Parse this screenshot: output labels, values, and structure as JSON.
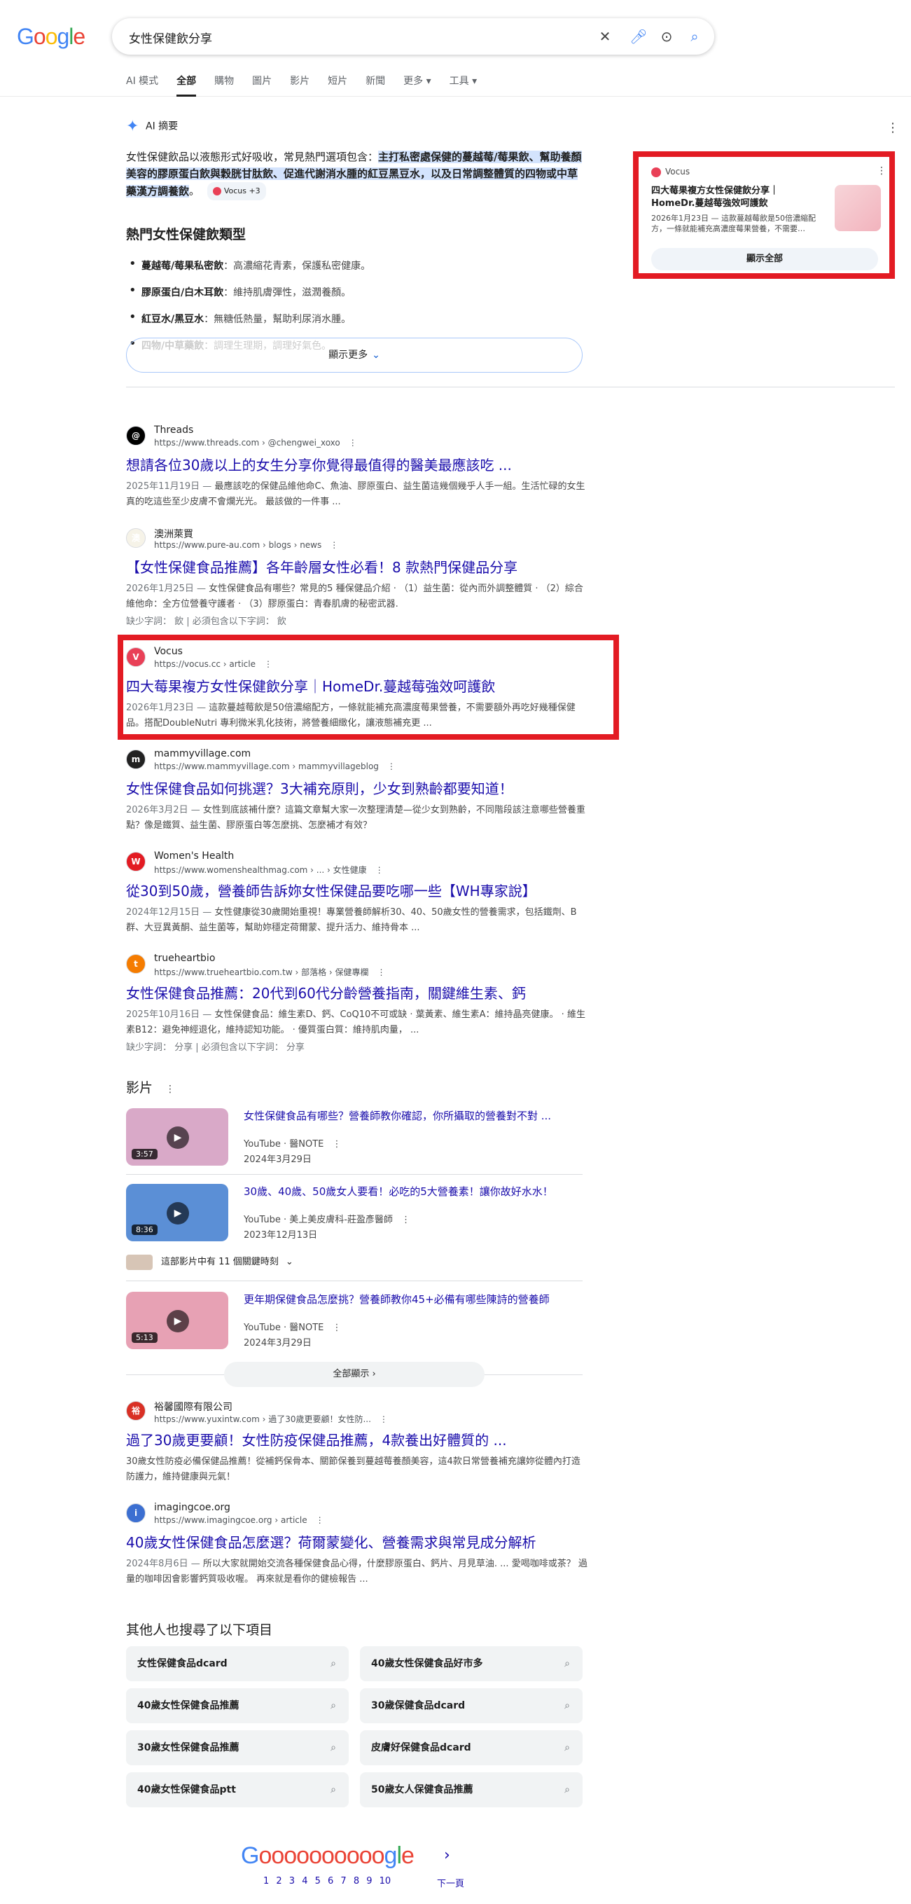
{
  "header": {
    "logo": "Google",
    "search_query": "女性保健飲分享",
    "tabs": [
      "AI 模式",
      "全部",
      "購物",
      "圖片",
      "影片",
      "短片",
      "新聞",
      "更多 ▾",
      "工具 ▾"
    ],
    "active_tab": "全部"
  },
  "ai_overview": {
    "heading": "AI 摘要",
    "intro_plain": "女性保健飲品以液態形式好吸收，常見熱門選項包含：",
    "intro_bold": "主打私密處保健的蔓越莓/莓果飲、幫助養顏美容的膠原蛋白飲與穀胱甘肽飲、促進代謝消水腫的紅豆黑豆水，以及日常調整體質的四物或中草藥漢方調養飲",
    "intro_end": "。",
    "chip": "Vocus +3",
    "subtitle": "熱門女性保健飲類型",
    "items": [
      {
        "bold": "蔓越莓/莓果私密飲",
        "text": "：高濃縮花青素，保護私密健康。"
      },
      {
        "bold": "膠原蛋白/白木耳飲",
        "text": "：維持肌膚彈性，滋潤養顏。"
      },
      {
        "bold": "紅豆水/黑豆水",
        "text": "：無糖低熱量，幫助利尿消水腫。"
      },
      {
        "bold": "四物/中草藥飲",
        "text": "：調理生理期，調理好氣色。"
      }
    ],
    "show_more": "顯示更多"
  },
  "side_card": {
    "source": "Vocus",
    "title": "四大莓果複方女性保健飲分享｜HomeDr.蔓越莓強效呵護飲",
    "snippet": "2026年1月23日 — 這款蔓越莓飲是50倍濃縮配方，一條就能補充高濃度莓果營養，不需要…",
    "show_all": "顯示全部"
  },
  "results": [
    {
      "name": "Threads",
      "url": "https://www.threads.com › @chengwei_xoxo",
      "title": "想請各位30歲以上的女生分享你覺得最值得的醫美最應該吃 ...",
      "date": "2025年11月19日 — ",
      "snippet": "最應該吃的保健品維他命C、魚油、膠原蛋白、益生菌這幾個幾乎人手一組。生活忙碌的女生真的吃這些至少皮膚不會爛光光。 最該做的一件事 ...",
      "missing": "",
      "fav_color": "#000000",
      "fav_char": "@"
    },
    {
      "name": "澳洲萊買",
      "url": "https://www.pure-au.com › blogs › news",
      "title": "【女性保健食品推薦】各年齡層女性必看！8 款熱門保健品分享",
      "date": "2026年1月25日 — ",
      "snippet": "女性保健食品有哪些？常見的5 種保健品介紹 · （1）益生菌：從內而外調整體質 · （2）綜合維他命：全方位營養守護者 · （3）膠原蛋白：青春肌膚的秘密武器.",
      "missing": "缺少字詞： 飲 | 必須包含以下字詞： 飲",
      "fav_color": "#f6f3e8",
      "fav_char": "澳"
    },
    {
      "name": "Vocus",
      "url": "https://vocus.cc › article",
      "title": "四大莓果複方女性保健飲分享｜HomeDr.蔓越莓強效呵護飲",
      "date": "2026年1月23日 — ",
      "snippet": "這款蔓越莓飲是50倍濃縮配方，一條就能補充高濃度莓果營養，不需要額外再吃好幾種保健品。搭配DoubleNutri 專利微米乳化技術，將營養細緻化，讓液態補充更 ...",
      "missing": "",
      "fav_color": "#e94057",
      "fav_char": "V"
    },
    {
      "name": "mammyvillage.com",
      "url": "https://www.mammyvillage.com › mammyvillageblog",
      "title": "女性保健食品如何挑選？3大補充原則，少女到熟齡都要知道！",
      "date": "2026年3月2日 — ",
      "snippet": "女性到底該補什麼？這篇文章幫大家一次整理清楚—從少女到熟齡，不同階段該注意哪些營養重點？像是鐵質、益生菌、膠原蛋白等怎麼挑、怎麼補才有效？",
      "missing": "",
      "fav_color": "#222222",
      "fav_char": "m"
    },
    {
      "name": "Women's Health",
      "url": "https://www.womenshealthmag.com › ... › 女性健康",
      "title": "從30到50歲，營養師告訴妳女性保健品要吃哪一些【WH專家說】",
      "date": "2024年12月15日 — ",
      "snippet": "女性健康從30歲開始重視！專業營養師解析30、40、50歲女性的營養需求，包括鐵劑、B群、大豆異黃酮、益生菌等，幫助妳穩定荷爾蒙、提升活力、維持骨本 ...",
      "missing": "",
      "fav_color": "#e31b23",
      "fav_char": "W"
    },
    {
      "name": "trueheartbio",
      "url": "https://www.trueheartbio.com.tw › 部落格 › 保健專欄",
      "title": "女性保健食品推薦：20代到60代分齡營養指南，關鍵維生素、鈣",
      "date": "2025年10月16日 — ",
      "snippet": "女性保健食品：維生素D、鈣、CoQ10不可或缺 · 葉黃素、維生素A：維持晶亮健康。 · 維生素B12：避免神經退化，維持認知功能。 · 優質蛋白質：維持肌肉量， ...",
      "missing": "缺少字詞： 分享 | 必須包含以下字詞： 分享",
      "fav_color": "#f57c00",
      "fav_char": "t"
    }
  ],
  "videos": {
    "heading": "影片",
    "items": [
      {
        "title": "女性保健食品有哪些？營養師教你確認，你所攝取的營養對不對 ...",
        "meta": "YouTube · 醫NOTE",
        "date": "2024年3月29日",
        "duration": "3:57",
        "thumb_color": "#d9a9c8"
      },
      {
        "title": "30歲、40歲、50歲女人要看！必吃的5大營養素！讓你故好水水！",
        "meta": "YouTube · 美上美皮膚科-莊盈彥醫師",
        "date": "2023年12月13日",
        "duration": "8:36",
        "thumb_color": "#5b8fd6"
      },
      {
        "title": "更年期保健食品怎麼挑？營養師教你45+必備有哪些陳詩的營養師",
        "meta": "YouTube · 醫NOTE",
        "date": "2024年3月29日",
        "duration": "5:13",
        "thumb_color": "#e7a1b4"
      }
    ],
    "key_moments": "這部影片中有 11 個關鍵時刻",
    "show_all": "全部顯示"
  },
  "results_2": [
    {
      "name": "裕馨國際有限公司",
      "url": "https://www.yuxintw.com › 過了30歲更要顧！女性防...",
      "title": "過了30歲更要顧！女性防疫保健品推薦，4款養出好體質的 ...",
      "date": "",
      "snippet": "30歲女性防疫必備保健品推薦！從補鈣保骨本、關節保養到蔓越莓養顏美容，這4款日常營養補充讓妳從體內打造防護力，維持健康與元氣！",
      "missing": "",
      "fav_color": "#d93025",
      "fav_char": "裕"
    },
    {
      "name": "imagingcoe.org",
      "url": "https://www.imagingcoe.org › article",
      "title": "40歲女性保健食品怎麼選？荷爾蒙變化、營養需求與常見成分解析",
      "date": "2024年8月6日 — ",
      "snippet": "所以大家就開始交流各種保健食品心得，什麼膠原蛋白、鈣片、月見草油. ... 愛喝咖啡或茶？ 過量的咖啡因會影響鈣質吸收喔。 再來就是看你的健檢報告 ...",
      "missing": "",
      "fav_color": "#3c6fd1",
      "fav_char": "i"
    }
  ],
  "related": {
    "heading": "其他人也搜尋了以下項目",
    "items": [
      "女性保健食品dcard",
      "40歲女性保健食品好市多",
      "40歲女性保健食品推薦",
      "30歲保健食品dcard",
      "30歲女性保健食品推薦",
      "皮膚好保健食品dcard",
      "40歲女性保健食品ptt",
      "50歲女人保健食品推薦"
    ]
  },
  "pagination": {
    "numbers": "1 2 3 4 5 6 7 8 9 10",
    "current": "1",
    "next": "下一頁"
  }
}
